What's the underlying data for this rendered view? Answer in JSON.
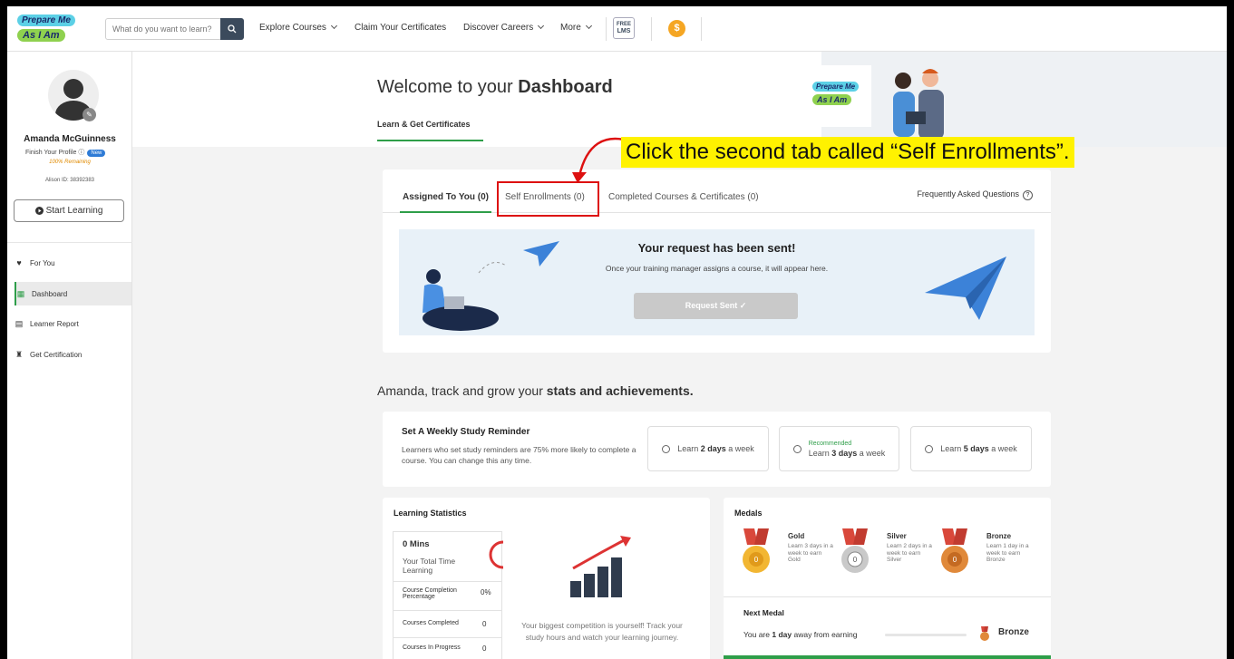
{
  "header": {
    "logo_line1": "Prepare Me",
    "logo_line2": "As I Am",
    "search_placeholder": "What do you want to learn?",
    "nav": [
      {
        "label": "Explore Courses",
        "has_menu": true
      },
      {
        "label": "Claim Your Certificates",
        "has_menu": false
      },
      {
        "label": "Discover Careers",
        "has_menu": true
      },
      {
        "label": "More",
        "has_menu": true
      }
    ],
    "lms_badge_top": "FREE",
    "lms_badge_bottom": "LMS",
    "coin_symbol": "$"
  },
  "sidebar": {
    "user_name": "Amanda McGuinness",
    "finish_profile": "Finish Your Profile",
    "new_badge": "New",
    "remaining": "100% Remaining",
    "alison_id": "Alison ID: 38392383",
    "start_button": "Start Learning",
    "items": [
      {
        "label": "For You",
        "icon": "heart-icon",
        "active": false
      },
      {
        "label": "Dashboard",
        "icon": "dashboard-icon",
        "active": true
      },
      {
        "label": "Learner Report",
        "icon": "report-icon",
        "active": false
      },
      {
        "label": "Get Certification",
        "icon": "certificate-icon",
        "active": false
      }
    ]
  },
  "dashboard": {
    "welcome_prefix": "Welcome to your",
    "welcome_bold": "Dashboard",
    "subtab": "Learn & Get Certificates",
    "hero_logo_line1": "Prepare Me",
    "hero_logo_line2": "As I Am"
  },
  "callout": "Click the second tab called “Self Enrollments”.",
  "enrollment": {
    "tabs": [
      {
        "label": "Assigned To You (0)",
        "active": true
      },
      {
        "label": "Self Enrollments (0)",
        "active": false
      },
      {
        "label": "Completed Courses & Certificates (0)",
        "active": false
      }
    ],
    "faq": "Frequently Asked Questions",
    "banner_title": "Your request has been sent!",
    "banner_subtitle": "Once your training manager assigns a course, it will appear here.",
    "request_button": "Request Sent ✓"
  },
  "stats_heading": {
    "prefix": "Amanda, track and grow your",
    "bold": "stats and achievements."
  },
  "reminder": {
    "title": "Set A Weekly Study Reminder",
    "description": "Learners who set study reminders are 75% more likely to complete a course. You can change this any time.",
    "options": [
      {
        "prefix": "Learn",
        "bold": "2 days",
        "suffix": "a week",
        "recommended": ""
      },
      {
        "prefix": "Learn",
        "bold": "3 days",
        "suffix": "a week",
        "recommended": "Recommended"
      },
      {
        "prefix": "Learn",
        "bold": "5 days",
        "suffix": "a week",
        "recommended": ""
      }
    ]
  },
  "learning_stats": {
    "title": "Learning Statistics",
    "time_value": "0 Mins",
    "time_label": "Your Total Time Learning",
    "rows": [
      {
        "label": "Course Completion Percentage",
        "value": "0%"
      },
      {
        "label": "Courses Completed",
        "value": "0"
      },
      {
        "label": "Courses In Progress",
        "value": "0"
      }
    ],
    "competition": "Your biggest competition is yourself! Track your study hours and watch your learning journey."
  },
  "medals": {
    "title": "Medals",
    "items": [
      {
        "name": "Gold",
        "desc": "Learn 3 days in a week to earn Gold",
        "color": "#f2b632"
      },
      {
        "name": "Silver",
        "desc": "Learn 2 days in a week to earn Silver",
        "color": "#b9b9b9"
      },
      {
        "name": "Bronze",
        "desc": "Learn 1 day in a week to earn Bronze",
        "color": "#e0893a"
      }
    ],
    "next_title": "Next Medal",
    "next_prefix": "You are",
    "next_bold": "1 day",
    "next_suffix": "away from earning",
    "next_medal": "Bronze"
  },
  "colors": {
    "accent_green": "#2e9e49",
    "callout_yellow": "#fff200",
    "highlight_red": "#d11111"
  }
}
